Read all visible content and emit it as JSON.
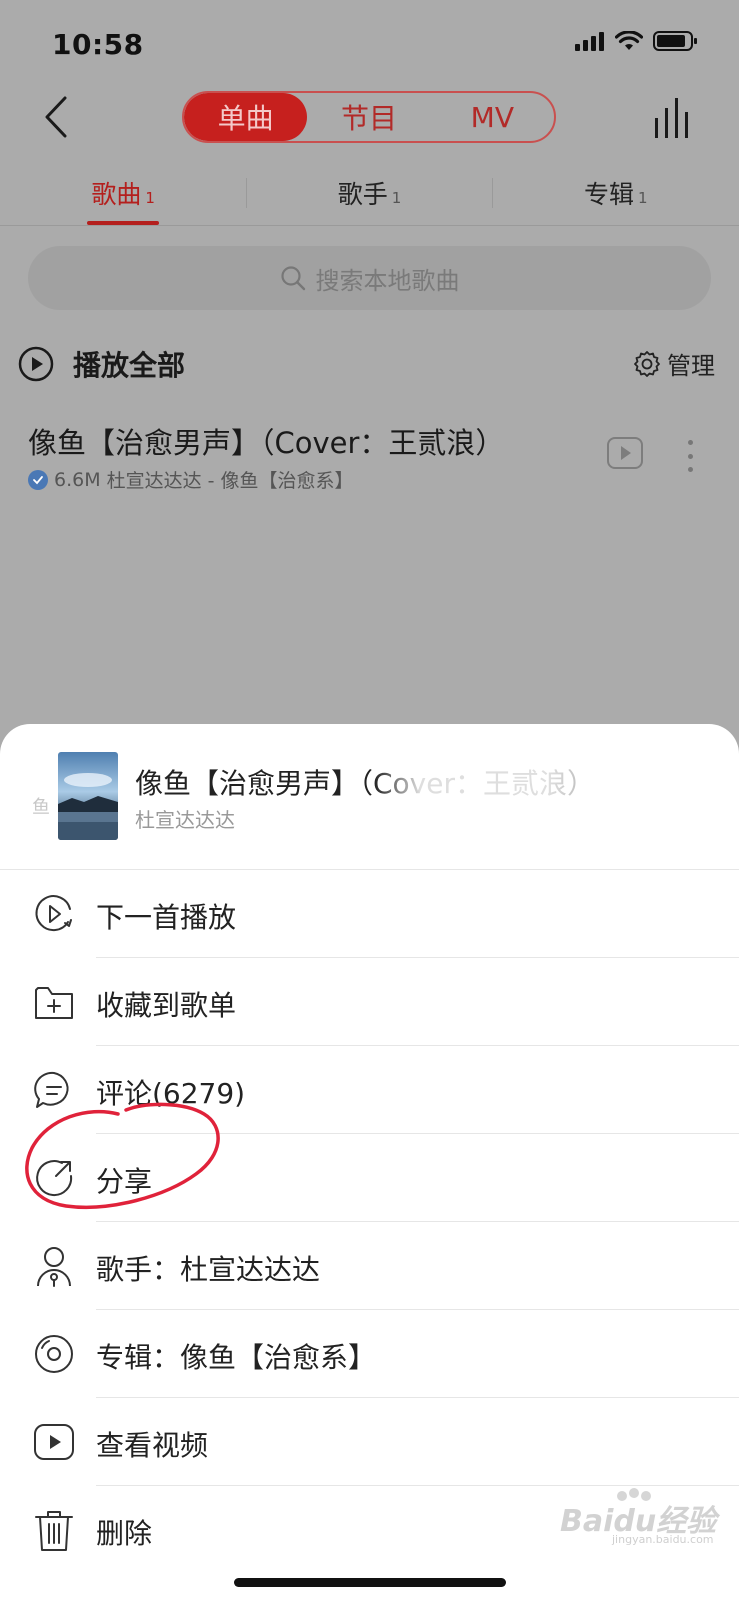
{
  "status_bar": {
    "time": "10:58"
  },
  "nav": {
    "segments": [
      {
        "label": "单曲",
        "active": true
      },
      {
        "label": "节目",
        "active": false
      },
      {
        "label": "MV",
        "active": false
      }
    ]
  },
  "tabs": [
    {
      "label": "歌曲",
      "count": "1",
      "active": true
    },
    {
      "label": "歌手",
      "count": "1",
      "active": false
    },
    {
      "label": "专辑",
      "count": "1",
      "active": false
    }
  ],
  "search": {
    "placeholder": "搜索本地歌曲"
  },
  "list_header": {
    "play_all": "播放全部",
    "manage": "管理"
  },
  "song": {
    "title": "像鱼【治愈男声】（Cover：王贰浪）",
    "size": "6.6M",
    "meta": "杜宣达达达 - 像鱼【治愈系】"
  },
  "sheet": {
    "cover_text": "鱼",
    "title": "像鱼【治愈男声】（Cover：王贰浪）",
    "artist": "杜宣达达达",
    "menu": [
      {
        "label": "下一首播放",
        "icon": "play-next-icon"
      },
      {
        "label": "收藏到歌单",
        "icon": "add-folder-icon"
      },
      {
        "label": "评论(6279)",
        "icon": "comment-icon"
      },
      {
        "label": "分享",
        "icon": "share-icon"
      },
      {
        "label": "歌手：杜宣达达达",
        "icon": "artist-icon"
      },
      {
        "label": "专辑：像鱼【治愈系】",
        "icon": "album-icon"
      },
      {
        "label": "查看视频",
        "icon": "video-icon"
      },
      {
        "label": "删除",
        "icon": "trash-icon"
      }
    ]
  },
  "watermark": {
    "text": "Baidu经验",
    "sub": "jingyan.baidu.com"
  },
  "colors": {
    "accent": "#c6201e",
    "annotation": "#e0223a",
    "overlay": "#ababab"
  }
}
